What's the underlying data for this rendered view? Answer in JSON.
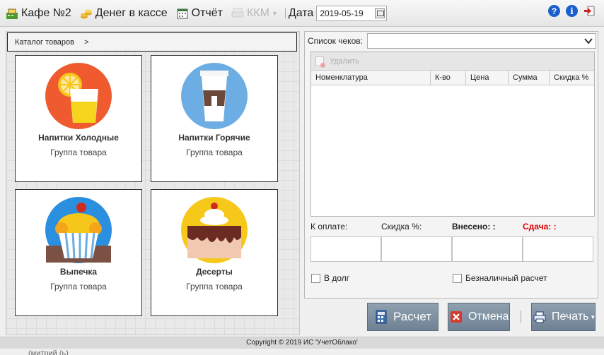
{
  "toolbar": {
    "cafe_label": "Кафе №2",
    "cash_label": "Денег в кассе",
    "report_label": "Отчёт",
    "kkm_label": "ККМ",
    "date_label": "Дата",
    "date_value": "2019-05-19",
    "help_icon": "?",
    "info_icon": "i"
  },
  "catalog": {
    "breadcrumb": "Каталог товаров",
    "breadcrumb_sep": ">",
    "tiles": [
      {
        "name": "Напитки Холодные",
        "sub": "Группа товара"
      },
      {
        "name": "Напитки Горячие",
        "sub": "Группа товара"
      },
      {
        "name": "Выпечка",
        "sub": "Группа товара"
      },
      {
        "name": "Десерты",
        "sub": "Группа товара"
      }
    ]
  },
  "checks": {
    "label": "Список чеков:",
    "selected": "",
    "delete_label": "Удалить",
    "columns": [
      "Номенклатура",
      "К-во",
      "Цена",
      "Сумма",
      "Скидка %"
    ],
    "rows": []
  },
  "totals": {
    "to_pay_label": "К оплате:",
    "discount_label": "Скидка %:",
    "paid_label": "Внесено: :",
    "change_label": "Сдача: :",
    "change_color": "#e00000"
  },
  "options": {
    "debt_label": "В долг",
    "cashless_label": "Безналичный расчет"
  },
  "buttons": {
    "calc_label": "Расчет",
    "cancel_label": "Отмена",
    "print_label": "Печать"
  },
  "footer": {
    "copyright": "Copyright © 2019 ИС 'УчетОблако'",
    "under_text": "(митрий (ь)"
  }
}
